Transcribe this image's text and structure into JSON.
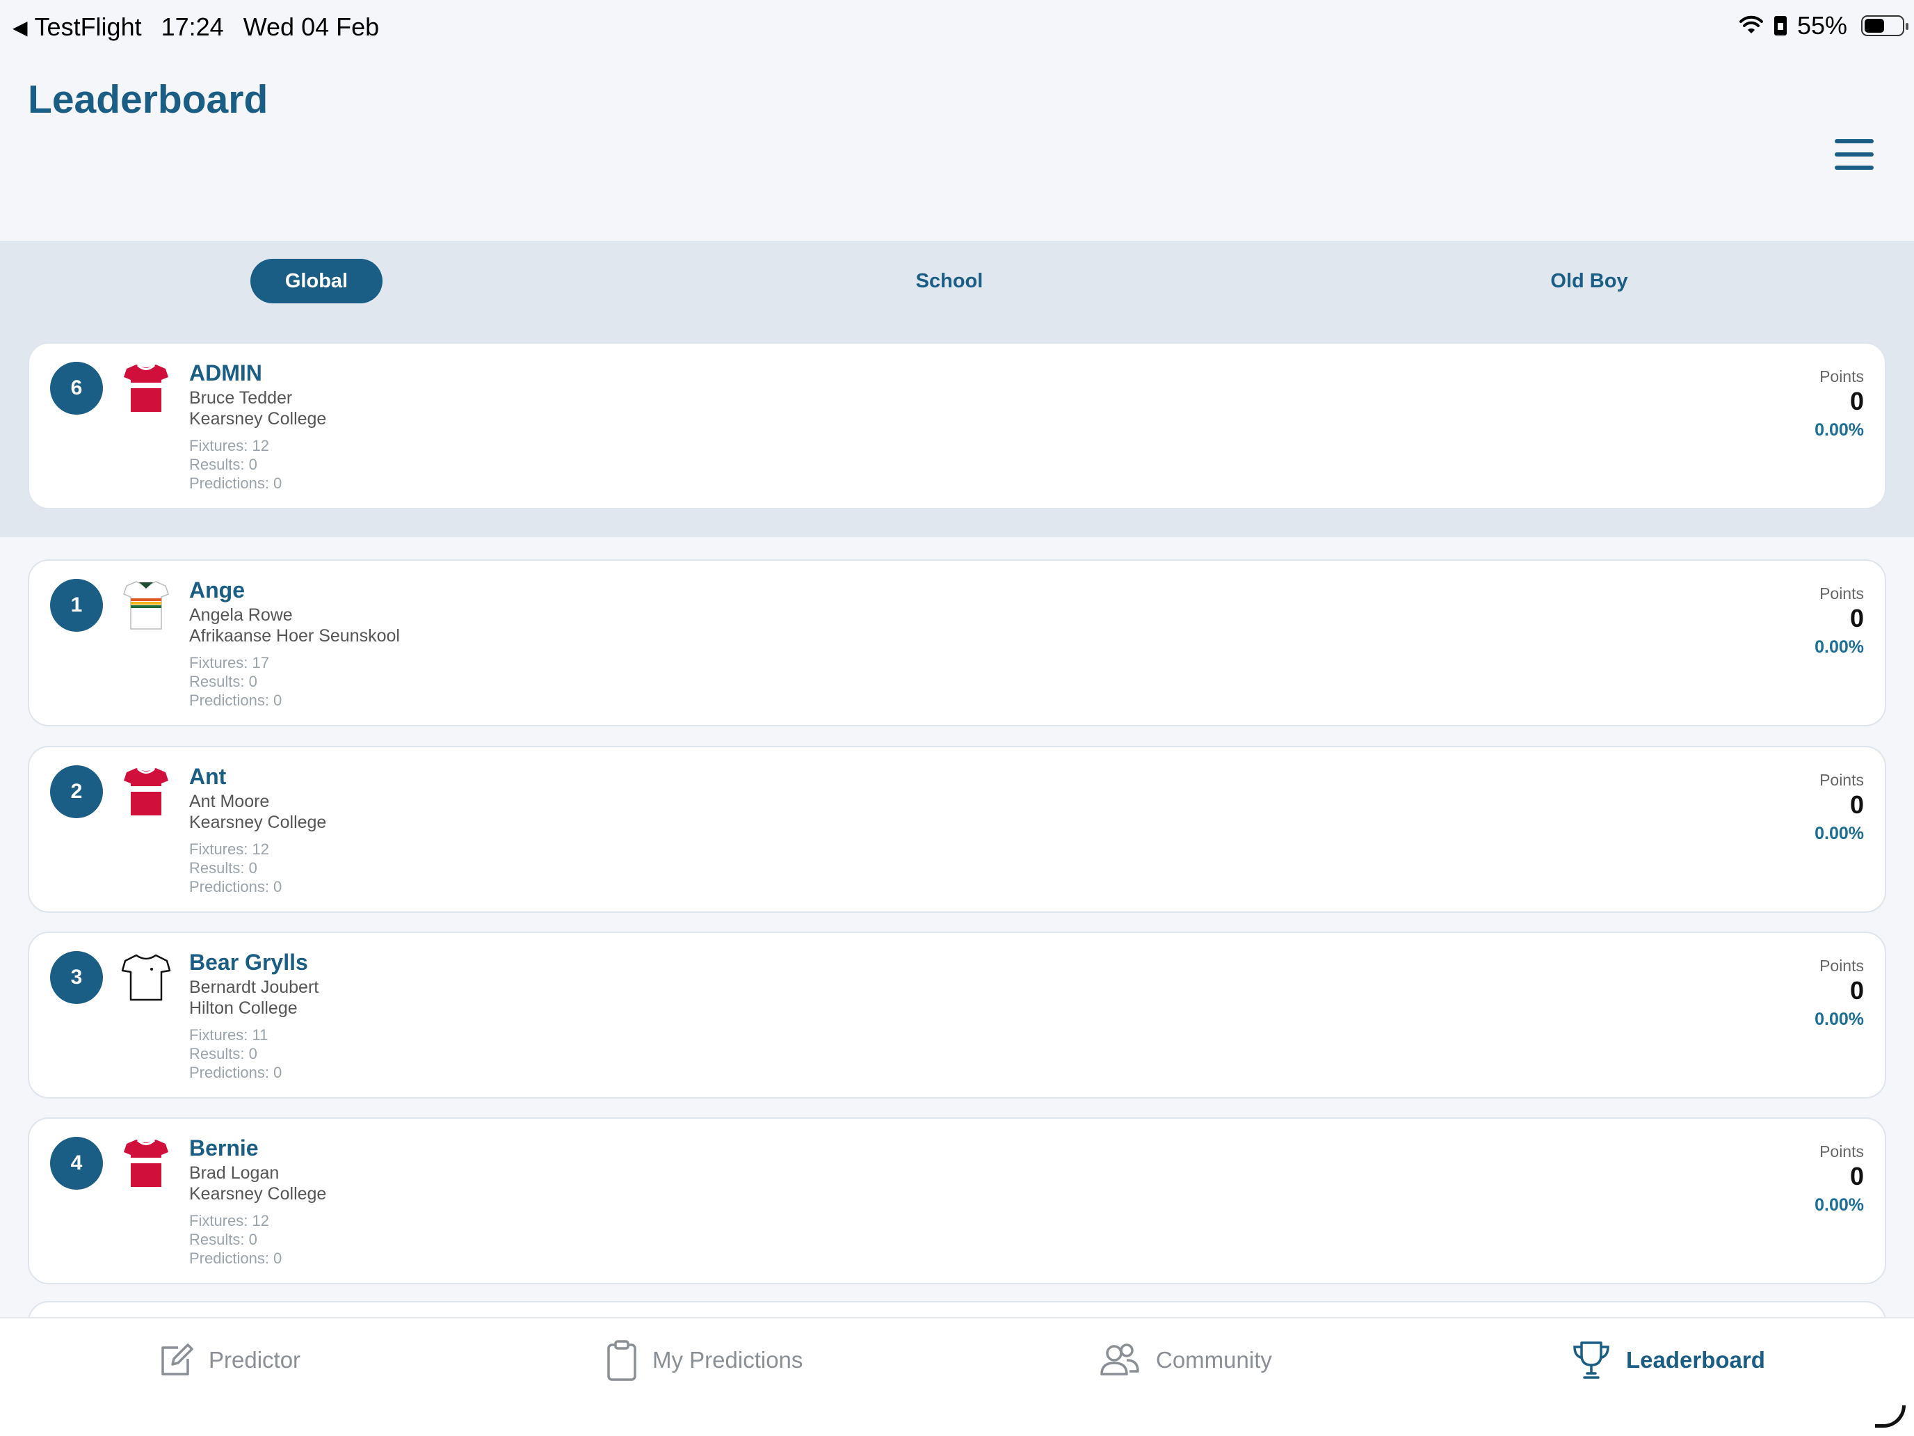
{
  "status_bar": {
    "back_app": "TestFlight",
    "time": "17:24",
    "date": "Wed 04 Feb",
    "battery": "55%"
  },
  "header": {
    "title": "Leaderboard",
    "menu_icon": "hamburger-menu-icon"
  },
  "tabs": [
    {
      "label": "Global",
      "active": true
    },
    {
      "label": "School",
      "active": false
    },
    {
      "label": "Old Boy",
      "active": false
    }
  ],
  "current_user": {
    "rank": "6",
    "nickname": "ADMIN",
    "full_name": "Bruce Tedder",
    "school": "Kearsney College",
    "fixtures": "Fixtures: 12",
    "results": "Results: 0",
    "predictions": "Predictions: 0",
    "points_label": "Points",
    "points": "0",
    "percentage": "0.00%",
    "jersey": "red-jersey"
  },
  "leaderboard": [
    {
      "rank": "1",
      "nickname": "Ange",
      "full_name": "Angela Rowe",
      "school": "Afrikaanse Hoer Seunskool",
      "fixtures": "Fixtures: 17",
      "results": "Results: 0",
      "predictions": "Predictions: 0",
      "points_label": "Points",
      "points": "0",
      "percentage": "0.00%",
      "jersey": "white-striped-jersey"
    },
    {
      "rank": "2",
      "nickname": "Ant",
      "full_name": "Ant Moore",
      "school": "Kearsney College",
      "fixtures": "Fixtures: 12",
      "results": "Results: 0",
      "predictions": "Predictions: 0",
      "points_label": "Points",
      "points": "0",
      "percentage": "0.00%",
      "jersey": "red-jersey"
    },
    {
      "rank": "3",
      "nickname": "Bear Grylls",
      "full_name": "Bernardt Joubert",
      "school": "Hilton College",
      "fixtures": "Fixtures: 11",
      "results": "Results: 0",
      "predictions": "Predictions: 0",
      "points_label": "Points",
      "points": "0",
      "percentage": "0.00%",
      "jersey": "outline-tshirt"
    },
    {
      "rank": "4",
      "nickname": "Bernie",
      "full_name": "Brad Logan",
      "school": "Kearsney College",
      "fixtures": "Fixtures: 12",
      "results": "Results: 0",
      "predictions": "Predictions: 0",
      "points_label": "Points",
      "points": "0",
      "percentage": "0.00%",
      "jersey": "red-jersey"
    }
  ],
  "tabbar": [
    {
      "label": "Predictor",
      "icon": "edit-icon",
      "active": false
    },
    {
      "label": "My Predictions",
      "icon": "clipboard-icon",
      "active": false
    },
    {
      "label": "Community",
      "icon": "people-icon",
      "active": false
    },
    {
      "label": "Leaderboard",
      "icon": "trophy-icon",
      "active": true
    }
  ],
  "colors": {
    "brand": "#1b5e85",
    "background": "#f4f6f9",
    "tab_band": "#e1e7ee",
    "jersey_red": "#d0103a"
  }
}
